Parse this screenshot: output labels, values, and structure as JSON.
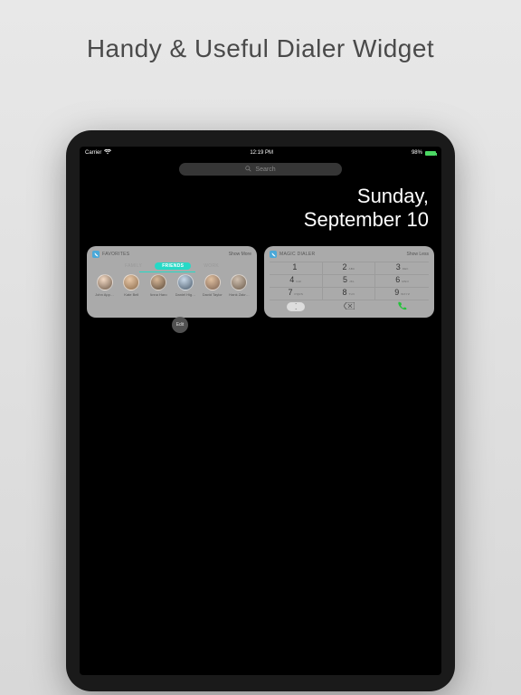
{
  "promo": {
    "title": "Handy & Useful Dialer Widget"
  },
  "status": {
    "carrier": "Carrier",
    "time": "12:19 PM",
    "battery": "98%"
  },
  "search": {
    "placeholder": "Search"
  },
  "date": {
    "weekday": "Sunday,",
    "month_day": "September 10"
  },
  "favorites": {
    "title": "FAVORITES",
    "action": "Show More",
    "tabs": {
      "family": "FAMILY",
      "friends": "FRIENDS",
      "work": "WORK"
    },
    "contacts": [
      {
        "name": "John App…"
      },
      {
        "name": "Kate Bell"
      },
      {
        "name": "Anna Haro"
      },
      {
        "name": "Daniel Hig…"
      },
      {
        "name": "David Taylor"
      },
      {
        "name": "Hank Zakr…"
      }
    ]
  },
  "dialer": {
    "title": "MAGIC DIALER",
    "action": "Show Less",
    "keys": [
      {
        "d": "1",
        "l": ""
      },
      {
        "d": "2",
        "l": "ABC"
      },
      {
        "d": "3",
        "l": "DEF"
      },
      {
        "d": "4",
        "l": "GHI"
      },
      {
        "d": "5",
        "l": "JKL"
      },
      {
        "d": "6",
        "l": "MNO"
      },
      {
        "d": "7",
        "l": "PQRS"
      },
      {
        "d": "8",
        "l": "TUV"
      },
      {
        "d": "9",
        "l": "WXYZ"
      }
    ]
  },
  "edit": {
    "label": "Edit"
  }
}
